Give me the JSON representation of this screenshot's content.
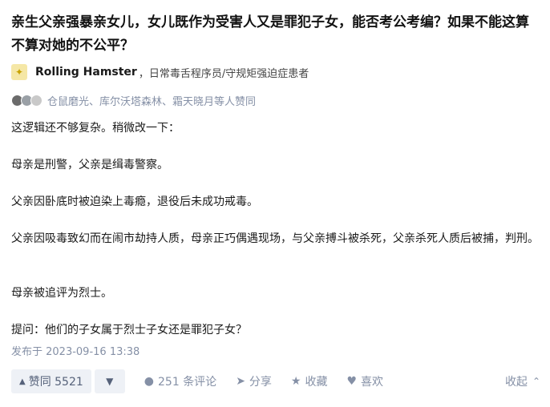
{
  "question": {
    "title": "亲生父亲强暴亲女儿，女儿既作为受害人又是罪犯子女，能否考公考编？如果不能这算不算对她的不公平？"
  },
  "author": {
    "name": "Rolling Hamster",
    "bio": "，日常毒舌程序员/守规矩强迫症患者"
  },
  "liked_by": "仓鼠磨光、库尔沃塔森林、霜天晓月等人赞同",
  "answer": {
    "paragraphs": [
      "这逻辑还不够复杂。稍微改一下：",
      "母亲是刑警，父亲是缉毒警察。",
      "父亲因卧底时被迫染上毒瘾，退役后未成功戒毒。",
      "父亲因吸毒致幻而在闹市劫持人质，母亲正巧偶遇现场，与父亲搏斗被杀死，父亲杀死人质后被捕，判刑。",
      "母亲被追评为烈士。",
      "提问：他们的子女属于烈士子女还是罪犯子女？"
    ],
    "published": "发布于 2023-09-16 13:38"
  },
  "actions": {
    "vote_up_label": "赞同 5521",
    "comments_label": "251 条评论",
    "share_label": "分享",
    "favorite_label": "收藏",
    "like_label": "喜欢",
    "collapse_label": "收起"
  },
  "icons": {
    "vote_up": "triangle-up-icon",
    "vote_down": "triangle-down-icon",
    "comment": "comment-bubble-icon",
    "share": "paper-plane-icon",
    "favorite": "star-icon",
    "like": "heart-icon",
    "collapse": "chevron-up-icon"
  },
  "colors": {
    "muted": "#8590a6",
    "vote_bg": "#eef1f6",
    "vote_text": "#56627a"
  }
}
